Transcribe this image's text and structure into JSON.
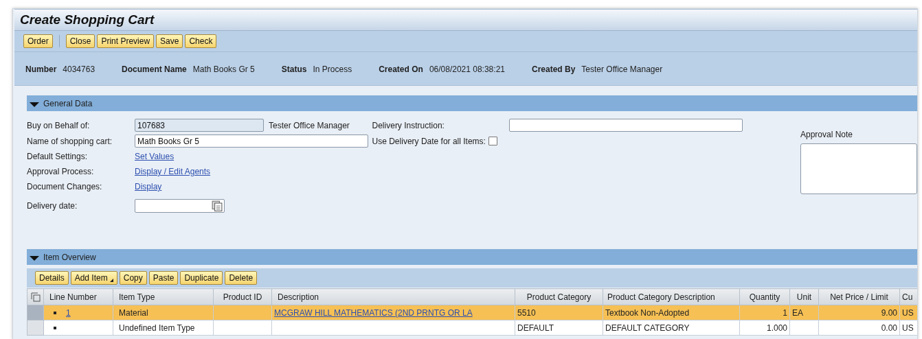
{
  "window": {
    "title": "Create Shopping Cart"
  },
  "toolbar_groups": [
    [
      {
        "label": "Order"
      }
    ],
    [
      {
        "label": "Close"
      },
      {
        "label": "Print Preview"
      },
      {
        "label": "Save"
      },
      {
        "label": "Check"
      }
    ]
  ],
  "header_fields": [
    {
      "label": "Number",
      "value": "4034763"
    },
    {
      "label": "Document Name",
      "value": "Math Books Gr 5"
    },
    {
      "label": "Status",
      "value": "In Process"
    },
    {
      "label": "Created On",
      "value": "06/08/2021 08:38:21"
    },
    {
      "label": "Created By",
      "value": "Tester Office Manager"
    }
  ],
  "general_data": {
    "title": "General Data",
    "expanded": true,
    "buy_on_behalf": {
      "label": "Buy on Behalf of:",
      "value": "107683",
      "name": "Tester Office Manager"
    },
    "cart_name": {
      "label": "Name of shopping cart:",
      "value": "Math Books Gr 5"
    },
    "links": [
      {
        "label": "Default Settings:",
        "link": "Set Values"
      },
      {
        "label": "Approval Process:",
        "link": "Display / Edit Agents"
      },
      {
        "label": "Document Changes:",
        "link": "Display"
      }
    ],
    "delivery_date": {
      "label": "Delivery date:"
    },
    "delivery_instruction": {
      "label": "Delivery Instruction:"
    },
    "use_delivery_date": {
      "label": "Use Delivery Date for all Items:",
      "checked": false
    },
    "approval_note": {
      "label": "Approval Note"
    }
  },
  "item_overview": {
    "title": "Item Overview",
    "expanded": true,
    "buttons": [
      {
        "label": "Details",
        "kind": "button"
      },
      {
        "label": "Add Item",
        "kind": "menu"
      },
      {
        "label": "Copy",
        "kind": "button"
      },
      {
        "label": "Paste",
        "kind": "button"
      },
      {
        "label": "Duplicate",
        "kind": "button"
      },
      {
        "label": "Delete",
        "kind": "button"
      }
    ],
    "columns": [
      "Line Number",
      "Item Type",
      "Product ID",
      "Description",
      "Product Category",
      "Product Category Description",
      "Quantity",
      "Unit",
      "Net Price / Limit",
      "Cu"
    ],
    "rows": [
      {
        "selected": true,
        "cells": [
          {
            "link": "1"
          },
          "Material",
          null,
          {
            "link": "MCGRAW HILL MATHEMATICS (2ND PRNTG OR LA"
          },
          "5510",
          "Textbook Non-Adopted",
          "1",
          "EA",
          "9.00",
          "US"
        ]
      },
      {
        "selected": false,
        "cells": [
          null,
          "Undefined Item Type",
          null,
          null,
          "DEFAULT",
          "DEFAULT CATEGORY",
          "1.000",
          null,
          "0.00",
          "US"
        ]
      }
    ]
  }
}
